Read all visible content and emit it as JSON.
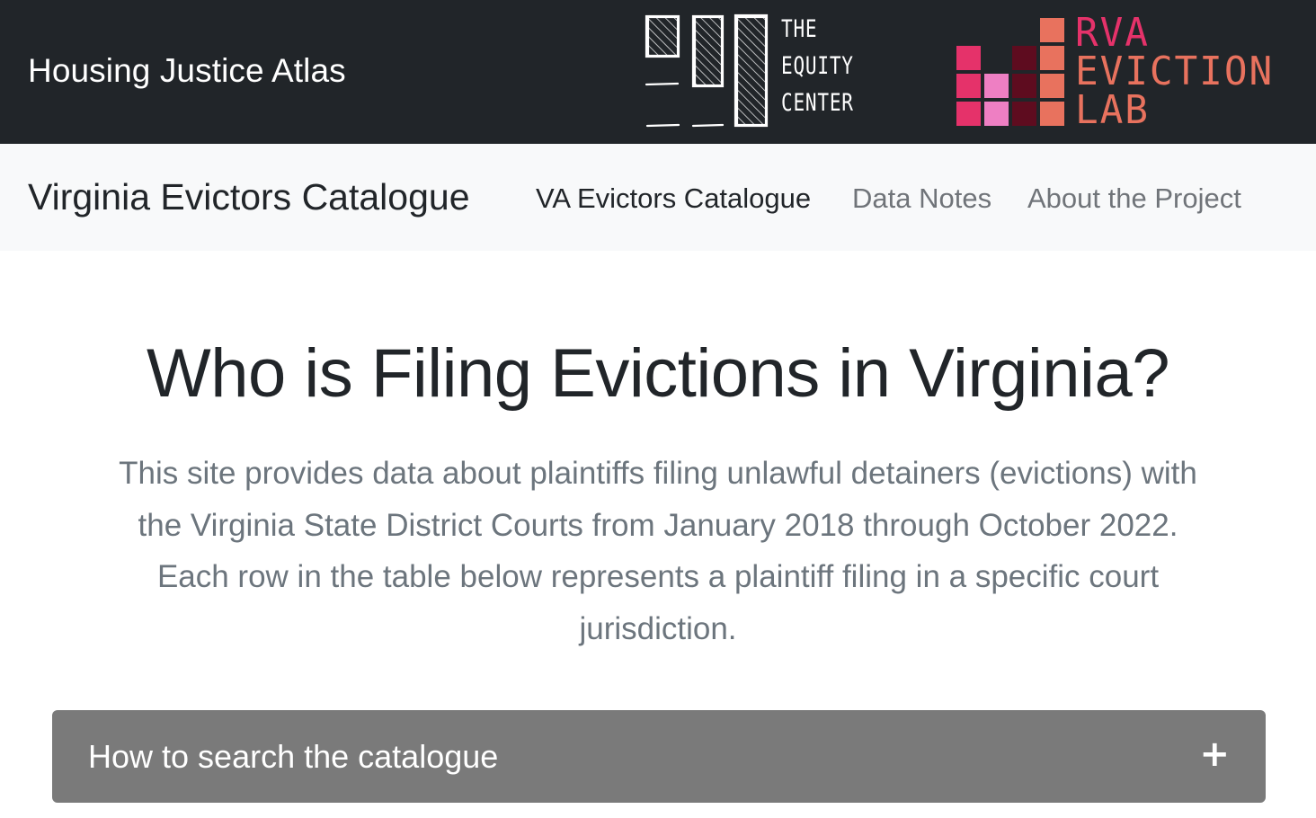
{
  "header": {
    "site_title": "Housing Justice Atlas",
    "equity_logo": {
      "icon": "equity-center-logo-icon",
      "lines": [
        "THE",
        "EQUITY",
        "CENTER"
      ]
    },
    "rva_logo": {
      "icon": "rva-eviction-lab-logo-icon",
      "lines": [
        "RVA",
        "EVICTION",
        "LAB"
      ],
      "colors": {
        "pink": "#e5326a",
        "light_pink": "#ee7fc3",
        "maroon": "#5e0c1f",
        "coral": "#e8725e"
      }
    }
  },
  "navbar": {
    "brand": "Virginia Evictors Catalogue",
    "links": [
      {
        "label": "VA Evictors Catalogue",
        "active": true
      },
      {
        "label": "Data Notes",
        "active": false
      },
      {
        "label": "About the Project",
        "active": false
      }
    ]
  },
  "main": {
    "title": "Who is Filing Evictions in Virginia?",
    "lead_lines": [
      "This site provides data about plaintiffs filing unlawful detainers (evictions) with",
      "the Virginia State District Courts from January 2018 through October 2022.",
      "Each row in the table below represents a plaintiff filing in a specific court",
      "jurisdiction."
    ],
    "accordion": {
      "label": "How to search the catalogue",
      "toggle_symbol": "+"
    }
  },
  "colors": {
    "topbar_bg": "#212529",
    "navbar_bg": "#f8f9fa",
    "accordion_bg": "#7a7a7a",
    "muted_text": "#6c757d"
  }
}
